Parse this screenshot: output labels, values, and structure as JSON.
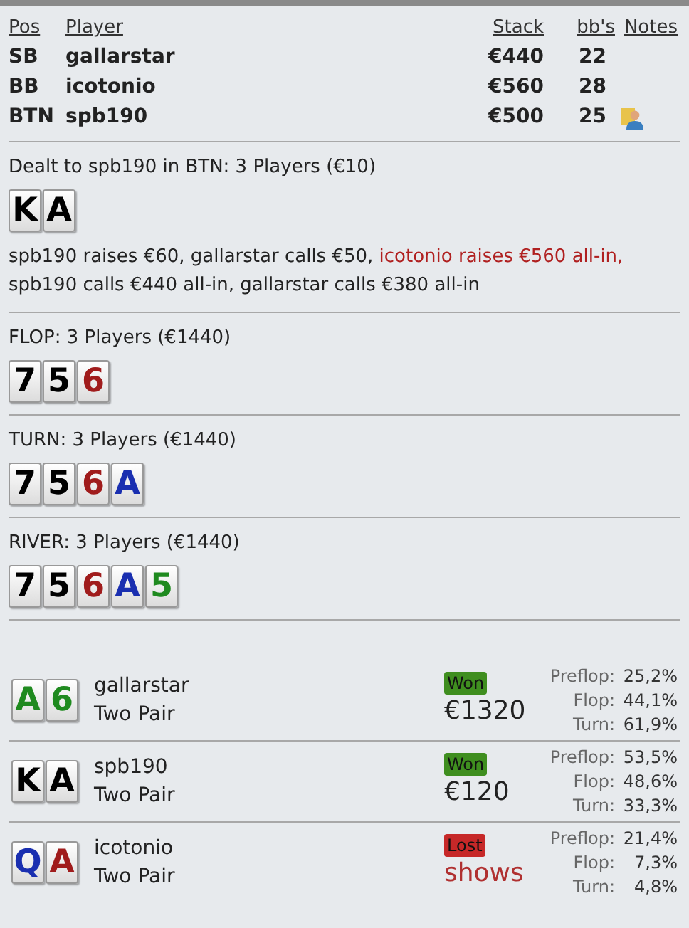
{
  "players_table": {
    "columns": [
      "Pos",
      "Player",
      "Stack",
      "bb's",
      "Notes"
    ],
    "rows": [
      {
        "pos": "SB",
        "player": "gallarstar",
        "stack": "€440",
        "bbs": "22",
        "has_note": false
      },
      {
        "pos": "BB",
        "player": "icotonio",
        "stack": "€560",
        "bbs": "28",
        "has_note": false
      },
      {
        "pos": "BTN",
        "player": "spb190",
        "stack": "€500",
        "bbs": "25",
        "has_note": true
      }
    ]
  },
  "streets": [
    {
      "title": "Dealt to spb190 in BTN: 3 Players (€10)",
      "cards": [
        {
          "rank": "K",
          "color": "#000000"
        },
        {
          "rank": "A",
          "color": "#000000"
        }
      ],
      "actions": [
        {
          "text": "spb190 raises €60, gallarstar calls €50, ",
          "highlight": false
        },
        {
          "text": "icotonio raises €560 all-in,",
          "highlight": true
        },
        {
          "text": " spb190 calls €440 all-in, gallarstar calls €380 all-in",
          "highlight": false
        }
      ]
    },
    {
      "title": "FLOP: 3 Players (€1440)",
      "cards": [
        {
          "rank": "7",
          "color": "#000000"
        },
        {
          "rank": "5",
          "color": "#000000"
        },
        {
          "rank": "6",
          "color": "#a01c1c"
        }
      ]
    },
    {
      "title": "TURN: 3 Players (€1440)",
      "cards": [
        {
          "rank": "7",
          "color": "#000000"
        },
        {
          "rank": "5",
          "color": "#000000"
        },
        {
          "rank": "6",
          "color": "#a01c1c"
        },
        {
          "rank": "A",
          "color": "#1a2fb0"
        }
      ]
    },
    {
      "title": "RIVER: 3 Players (€1440)",
      "cards": [
        {
          "rank": "7",
          "color": "#000000"
        },
        {
          "rank": "5",
          "color": "#000000"
        },
        {
          "rank": "6",
          "color": "#a01c1c"
        },
        {
          "rank": "A",
          "color": "#1a2fb0"
        },
        {
          "rank": "5",
          "color": "#1f8a1f"
        }
      ]
    }
  ],
  "results": [
    {
      "cards": [
        {
          "rank": "A",
          "color": "#1f8a1f"
        },
        {
          "rank": "6",
          "color": "#1f8a1f"
        }
      ],
      "player": "gallarstar",
      "hand": "Two Pair",
      "kind": "won",
      "badge": "Won",
      "amount": "€1320",
      "equity": [
        {
          "label": "Preflop:",
          "value": "25,2%"
        },
        {
          "label": "Flop:",
          "value": "44,1%"
        },
        {
          "label": "Turn:",
          "value": "61,9%"
        }
      ]
    },
    {
      "cards": [
        {
          "rank": "K",
          "color": "#000000"
        },
        {
          "rank": "A",
          "color": "#000000"
        }
      ],
      "player": "spb190",
      "hand": "Two Pair",
      "kind": "won",
      "badge": "Won",
      "amount": "€120",
      "equity": [
        {
          "label": "Preflop:",
          "value": "53,5%"
        },
        {
          "label": "Flop:",
          "value": "48,6%"
        },
        {
          "label": "Turn:",
          "value": "33,3%"
        }
      ]
    },
    {
      "cards": [
        {
          "rank": "Q",
          "color": "#1a2fb0"
        },
        {
          "rank": "A",
          "color": "#a01c1c"
        }
      ],
      "player": "icotonio",
      "hand": "Two Pair",
      "kind": "lost",
      "badge": "Lost",
      "amount": "shows",
      "equity": [
        {
          "label": "Preflop:",
          "value": "21,4%"
        },
        {
          "label": "Flop:",
          "value": "7,3%"
        },
        {
          "label": "Turn:",
          "value": "4,8%"
        }
      ]
    }
  ]
}
